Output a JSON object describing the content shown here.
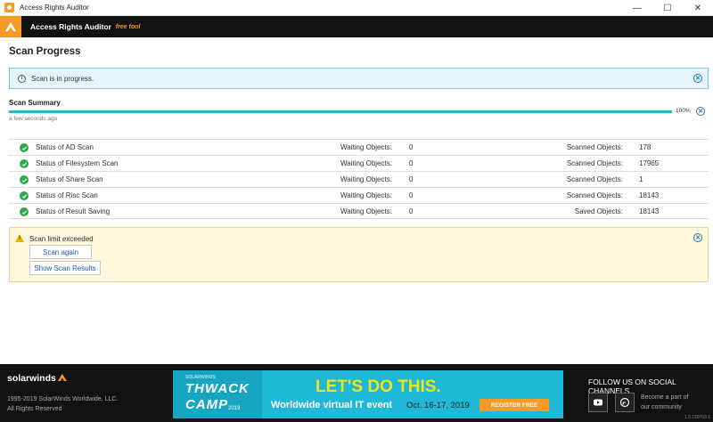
{
  "window": {
    "title": "Access Rights Auditor",
    "controls": {
      "minimize": "—",
      "maximize": "☐",
      "close": "✕"
    }
  },
  "header": {
    "app_name": "Access Rights Auditor",
    "badge": "free tool"
  },
  "page": {
    "title": "Scan Progress"
  },
  "info_banner": {
    "text": "Scan is in progress."
  },
  "summary": {
    "heading": "Scan Summary",
    "progress_percent": 100,
    "progress_label": "100%",
    "time_ago": "a few seconds ago"
  },
  "rows": [
    {
      "label": "Status of AD Scan",
      "waiting_label": "Waiting Objects:",
      "waiting_value": "0",
      "count_label": "Scanned Objects:",
      "count_value": "178"
    },
    {
      "label": "Status of Filesystem Scan",
      "waiting_label": "Waiting Objects:",
      "waiting_value": "0",
      "count_label": "Scanned Objects:",
      "count_value": "17965"
    },
    {
      "label": "Status of Share Scan",
      "waiting_label": "Waiting Objects:",
      "waiting_value": "0",
      "count_label": "Scanned Objects:",
      "count_value": "1"
    },
    {
      "label": "Status of Risc Scan",
      "waiting_label": "Waiting Objects:",
      "waiting_value": "0",
      "count_label": "Scanned Objects:",
      "count_value": "18143"
    },
    {
      "label": "Status of Result Saving",
      "waiting_label": "Waiting Objects:",
      "waiting_value": "0",
      "count_label": "Saved Objects:",
      "count_value": "18143"
    }
  ],
  "warning": {
    "text": "Scan limit exceeded",
    "scan_again": "Scan again",
    "show_results": "Show Scan Results"
  },
  "footer": {
    "brand": "solarwinds",
    "copyright_1": "1995-2019 SolarWinds Worldwide, LLC.",
    "copyright_2": "All Rights Reserved",
    "follow": "FOLLOW US ON SOCIAL CHANNELS",
    "community_1": "Become a part of",
    "community_2": "our community",
    "version": "1.0.190703.1"
  },
  "ad": {
    "brand_small": "SOLARWINDS",
    "thwack": "THWACK",
    "camp": "CAMP",
    "year": "2019",
    "headline": "LET'S DO THIS.",
    "subline": "Worldwide virtual IT event",
    "date": "Oct. 16-17, 2019",
    "cta": "REGISTER FREE"
  },
  "colors": {
    "accent_orange": "#f59a23",
    "progress_teal": "#28b8c8",
    "success_green": "#2ea84a",
    "info_bg": "#e5f4f8",
    "warning_bg": "#fdf7dc"
  },
  "icons": [
    "app-logo-icon",
    "info-icon",
    "close-icon",
    "check-icon",
    "warning-icon",
    "youtube-icon",
    "thwack-icon"
  ]
}
